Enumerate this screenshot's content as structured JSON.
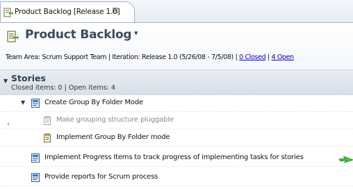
{
  "tab": {
    "title": "Product Backlog [Release 1.0]",
    "close_glyph": "☒",
    "icon": "backlog-icon"
  },
  "header": {
    "title": "Product Backlog",
    "dropdown_glyph": "▾",
    "icon": "backlog-icon",
    "info_prefix": "Team Area: Scrum Support Team | Iteration: Release 1.0 (5/26/08 - 7/5/08) | ",
    "closed_link": "0 Closed",
    "separator": " | ",
    "open_link": "4 Open"
  },
  "section": {
    "twisty": "▼",
    "title": "Stories",
    "summary": "Closed items: 0 | Open items: 4"
  },
  "side_arrow": "‹",
  "rows": [
    {
      "label": "Create Group By Folder Mode",
      "icon": "story-icon",
      "twisty": "▼",
      "dim": false
    },
    {
      "label": "Make grouping structure pluggable",
      "icon": "task-icon",
      "twisty": "",
      "dim": true
    },
    {
      "label": "Implement Group By Folder mode",
      "icon": "task-icon",
      "twisty": "",
      "dim": false
    },
    {
      "label": "Implement Progress Items to track progress of implementing tasks for stories",
      "icon": "story-icon",
      "twisty": "",
      "dim": false
    },
    {
      "label": "Provide reports for Scrum process",
      "icon": "story-icon",
      "twisty": "",
      "dim": false
    }
  ],
  "colors": {
    "title_text": "#3a4a5e",
    "link": "#0000cc",
    "section_bg": "#dde4ec",
    "dim_text": "#8a8a8a"
  }
}
